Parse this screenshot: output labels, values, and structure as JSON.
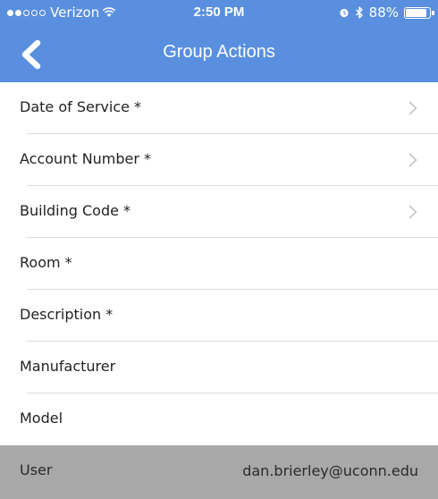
{
  "status_bar": {
    "carrier": "Verizon",
    "time": "2:50 PM",
    "battery": "88%",
    "battery_level": 0.88
  },
  "nav": {
    "title": "Group Actions",
    "back_icon": "chevron-left-icon"
  },
  "fields": [
    {
      "label": "Date of Service *",
      "has_chevron": true
    },
    {
      "label": "Account Number *",
      "has_chevron": true
    },
    {
      "label": "Building Code *",
      "has_chevron": true
    },
    {
      "label": "Room *",
      "has_chevron": false
    },
    {
      "label": "Description *",
      "has_chevron": false
    },
    {
      "label": "Manufacturer",
      "has_chevron": false
    },
    {
      "label": "Model",
      "has_chevron": false
    }
  ],
  "user": {
    "label": "User",
    "value": "dan.brierley@uconn.edu"
  },
  "colors": {
    "nav_background": "#5a8fe0",
    "user_row_background": "#a8a8a8",
    "separator": "#dddddd",
    "chevron": "#c4c4c4"
  }
}
